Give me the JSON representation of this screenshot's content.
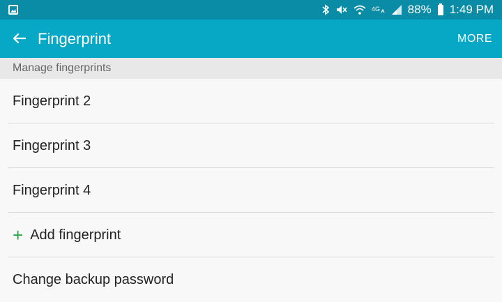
{
  "status_bar": {
    "battery_percent": "88%",
    "time": "1:49 PM",
    "icons": [
      "gallery-icon",
      "bluetooth-icon",
      "mute-icon",
      "wifi-icon",
      "4g-icon",
      "signal-icon",
      "battery-icon"
    ]
  },
  "app_bar": {
    "title": "Fingerprint",
    "more_label": "MORE"
  },
  "section": {
    "header": "Manage fingerprints"
  },
  "items": [
    {
      "label": "Fingerprint 2"
    },
    {
      "label": "Fingerprint 3"
    },
    {
      "label": "Fingerprint 4"
    },
    {
      "label": "Add fingerprint"
    },
    {
      "label": "Change backup password"
    }
  ],
  "colors": {
    "status_bar": "#0a8ba6",
    "app_bar": "#06a8c6",
    "accent_add": "#2ea84a"
  }
}
